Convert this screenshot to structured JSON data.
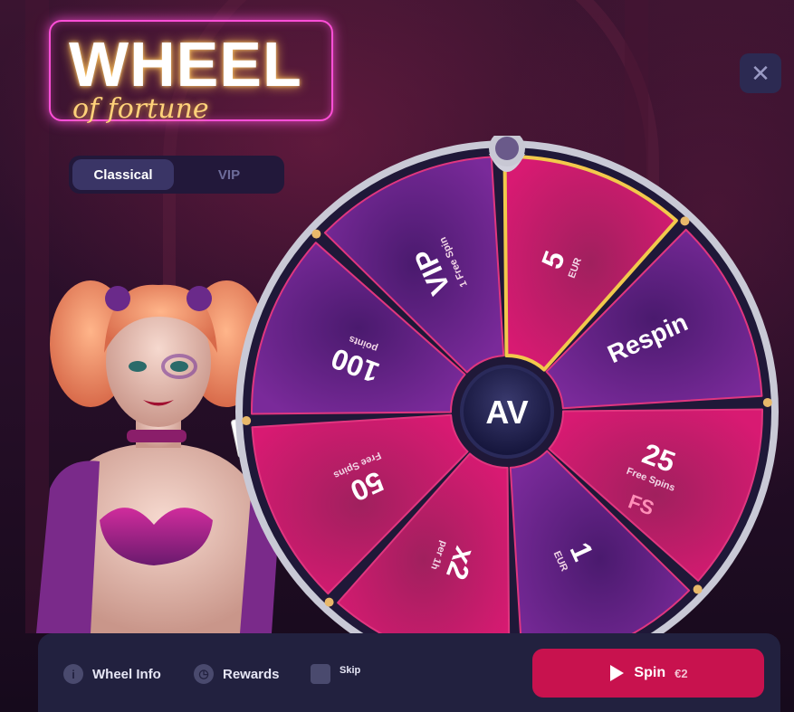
{
  "logo": {
    "title": "WHEEL",
    "subtitle": "of fortune"
  },
  "mode_tabs": {
    "active": "Classical",
    "inactive": "VIP"
  },
  "close_label": "✕",
  "wheel": {
    "center_logo": "AV",
    "segments": [
      {
        "main": "5",
        "sub": "EUR"
      },
      {
        "main": "Respin",
        "sub": ""
      },
      {
        "main": "25",
        "sub": "Free Spins",
        "badge": "FS"
      },
      {
        "main": "1",
        "sub": "EUR"
      },
      {
        "main": "x2",
        "sub": "per 1h"
      },
      {
        "main": "50",
        "sub": "Free Spins"
      },
      {
        "main": "100",
        "sub": "points"
      },
      {
        "main": "VIP",
        "sub": "1 Free Spin"
      }
    ]
  },
  "footer": {
    "wheel_info": "Wheel Info",
    "rewards": "Rewards",
    "skip": "Skip",
    "spin_label": "Spin",
    "spin_price": "€2"
  }
}
